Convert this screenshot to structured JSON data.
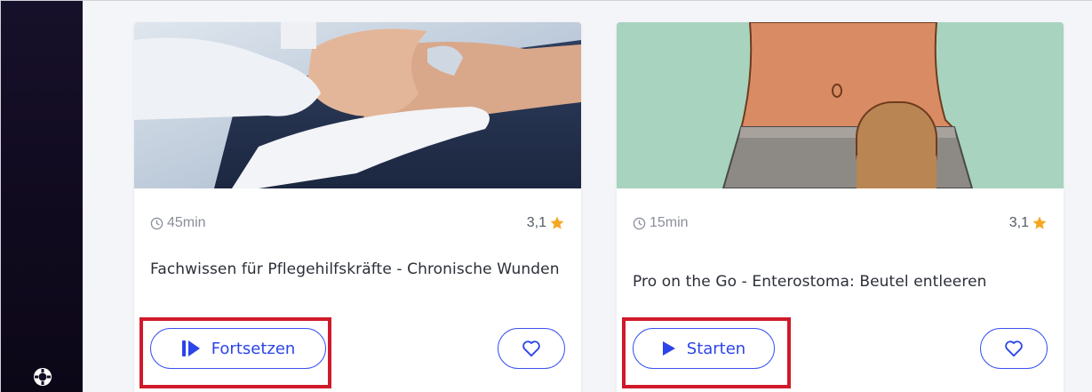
{
  "courses": [
    {
      "duration": "45min",
      "rating": "3,1",
      "title": "Fachwissen für Pflegehilfskräfte - Chronische Wunden",
      "action_label": "Fortsetzen"
    },
    {
      "duration": "15min",
      "rating": "3,1",
      "title": "Pro on the Go - Enterostoma: Beutel entleeren",
      "action_label": "Starten"
    }
  ],
  "colors": {
    "accent": "#3a52f2",
    "star": "#f5a623",
    "highlight": "#d01a2a",
    "sidebar": "#140d24"
  }
}
